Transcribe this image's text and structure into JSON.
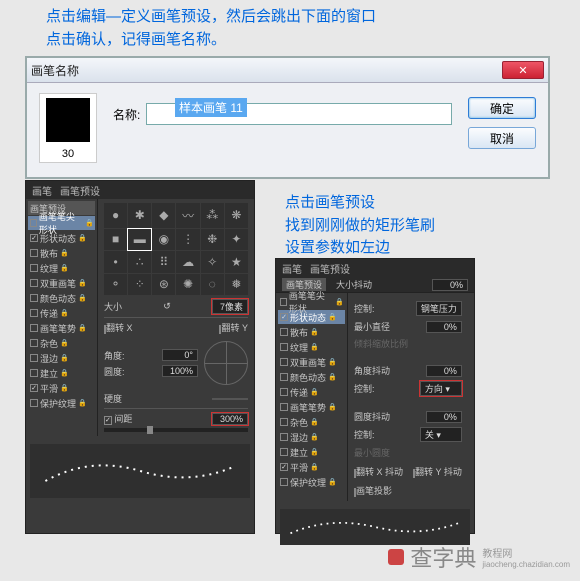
{
  "annotations": {
    "top": "点击编辑—定义画笔预设，然后会跳出下面的窗口\n点击确认，记得画笔名称。",
    "right": "点击画笔预设\n找到刚刚做的矩形笔刷\n设置参数如左边"
  },
  "dialog": {
    "title": "画笔名称",
    "preview_number": "30",
    "name_label": "名称:",
    "name_value": "样本画笔 11",
    "ok": "确定",
    "cancel": "取消"
  },
  "panel_left": {
    "tab1": "画笔",
    "tab2": "画笔预设",
    "section_header": "画笔预设",
    "checks": [
      {
        "label": "画笔笔尖形状",
        "highlight": true,
        "checked": false
      },
      {
        "label": "形状动态",
        "checked": true
      },
      {
        "label": "散布",
        "checked": false
      },
      {
        "label": "纹理",
        "checked": false
      },
      {
        "label": "双重画笔",
        "checked": false
      },
      {
        "label": "颜色动态",
        "checked": false
      },
      {
        "label": "传递",
        "checked": false
      },
      {
        "label": "画笔笔势",
        "checked": false
      },
      {
        "label": "杂色",
        "checked": false
      },
      {
        "label": "湿边",
        "checked": false
      },
      {
        "label": "建立",
        "checked": false
      },
      {
        "label": "平滑",
        "checked": true
      },
      {
        "label": "保护纹理",
        "checked": false
      }
    ],
    "size_label": "大小",
    "size_value": "7像素",
    "flip_x": "翻转 X",
    "flip_y": "翻转 Y",
    "angle_label": "角度:",
    "angle_value": "0°",
    "roundness_label": "圆度:",
    "roundness_value": "100%",
    "hardness_label": "硬度",
    "spacing_checkbox": "间距",
    "spacing_value": "300%"
  },
  "panel_right": {
    "tab1": "画笔",
    "tab2": "画笔预设",
    "sub_tab1": "画笔预设",
    "sub_tab2": "大小抖动",
    "sub_val": "0%",
    "checks": [
      {
        "label": "画笔笔尖形状",
        "checked": false
      },
      {
        "label": "形状动态",
        "checked": true,
        "highlight": true
      },
      {
        "label": "散布",
        "checked": false
      },
      {
        "label": "纹理",
        "checked": false
      },
      {
        "label": "双重画笔",
        "checked": false
      },
      {
        "label": "颜色动态",
        "checked": false
      },
      {
        "label": "传递",
        "checked": false
      },
      {
        "label": "画笔笔势",
        "checked": false
      },
      {
        "label": "杂色",
        "checked": false
      },
      {
        "label": "湿边",
        "checked": false
      },
      {
        "label": "建立",
        "checked": false
      },
      {
        "label": "平滑",
        "checked": true
      },
      {
        "label": "保护纹理",
        "checked": false
      }
    ],
    "control_label": "控制:",
    "control_value": "钢笔压力",
    "min_diameter_label": "最小直径",
    "min_diameter_value": "0%",
    "tilt_scale_label": "倾斜缩放比例",
    "angle_jitter_label": "角度抖动",
    "angle_jitter_value": "0%",
    "control2_label": "控制:",
    "control2_value": "方向",
    "roundness_jitter_label": "圆度抖动",
    "roundness_jitter_value": "0%",
    "control3_label": "控制:",
    "control3_value": "关",
    "min_roundness_label": "最小圆度",
    "flip_x_jitter": "翻转 X 抖动",
    "flip_y_jitter": "翻转 Y 抖动",
    "brush_projection": "画笔投影"
  },
  "watermark": {
    "main": "查字典",
    "sub": "教程网",
    "url": "jiaocheng.chazidian.com"
  }
}
